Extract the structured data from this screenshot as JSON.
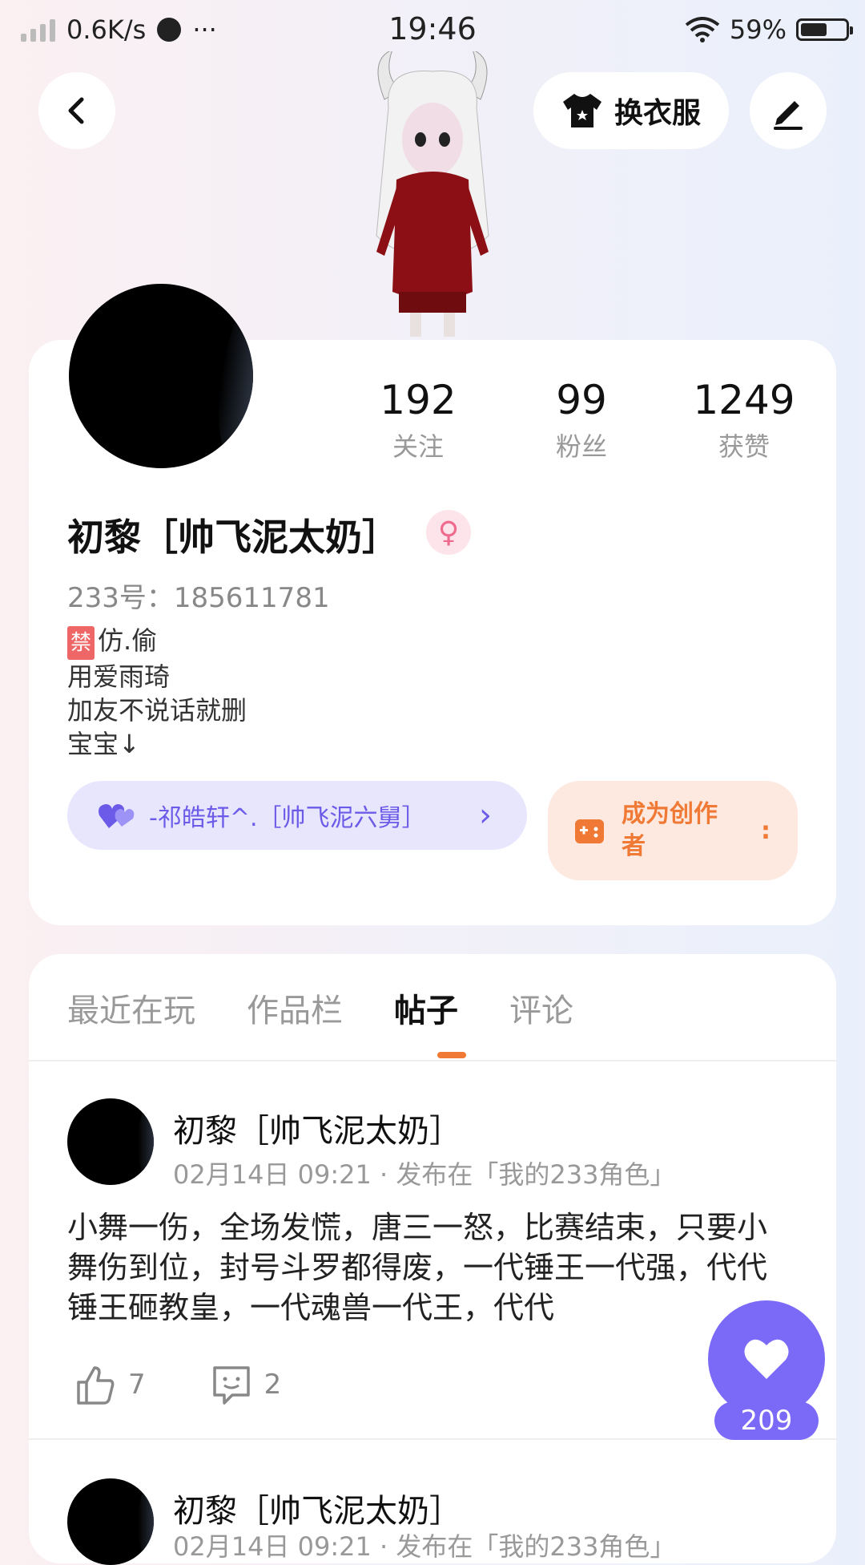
{
  "status_bar": {
    "speed": "0.6K/s",
    "more": "···",
    "time": "19:46",
    "battery_text": "59%",
    "battery_level": 0.59
  },
  "header": {
    "back_icon": "back-icon",
    "dress_label": "换衣服",
    "edit_icon": "edit-icon"
  },
  "profile": {
    "stats": [
      {
        "num": "192",
        "label": "关注"
      },
      {
        "num": "99",
        "label": "粉丝"
      },
      {
        "num": "1249",
        "label": "获赞"
      }
    ],
    "name": "初黎［帅飞泥太奶］",
    "gender_symbol": "♀",
    "id_text": "233号：185611781",
    "bio_ban": "禁",
    "bio_lines": [
      "仿.偷",
      "用爱雨琦",
      "加友不说话就删",
      "宝宝↓"
    ],
    "fan_pill": {
      "text": "-祁皓轩^.［帅飞泥六舅］",
      "chevron": "›"
    },
    "creator_pill": {
      "text": "成为创作者",
      "chevron": ":"
    }
  },
  "tabs": [
    {
      "label": "最近在玩"
    },
    {
      "label": "作品栏"
    },
    {
      "label": "帖子"
    },
    {
      "label": "评论"
    }
  ],
  "posts": [
    {
      "name": "初黎［帅飞泥太奶］",
      "meta": "02月14日 09:21 · 发布在「我的233角色」",
      "text": "小舞一伤，全场发慌，唐三一怒，比赛结束，只要小舞伤到位，封号斗罗都得废，一代锤王一代强，代代锤王砸教皇，一代魂兽一代王，代代",
      "likes": "7",
      "comments": "2"
    },
    {
      "name": "初黎［帅飞泥太奶］",
      "meta": "02月14日 09:21 · 发布在「我的233角色」"
    }
  ],
  "float_like": {
    "count": "209"
  },
  "colors": {
    "accent_orange": "#f07a35",
    "accent_purple": "#7a6af7"
  }
}
